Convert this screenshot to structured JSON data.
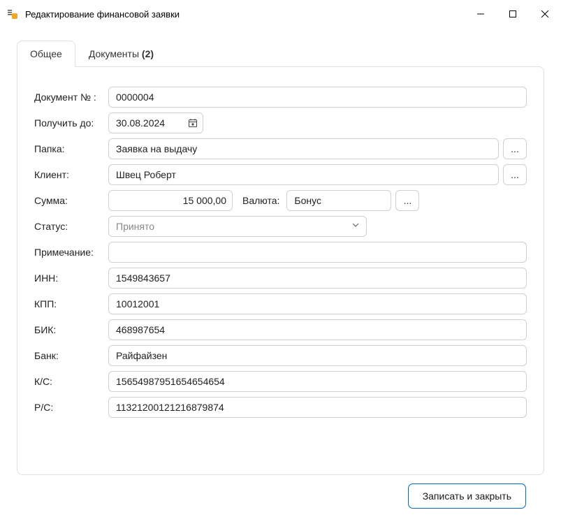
{
  "window": {
    "title": "Редактирование финансовой заявки"
  },
  "tabs": {
    "general": "Общее",
    "documents": "Документы",
    "documents_count": "(2)"
  },
  "labels": {
    "doc_number": "Документ № :",
    "receive_by": "Получить до:",
    "folder": "Папка:",
    "client": "Клиент:",
    "amount": "Сумма:",
    "currency": "Валюта:",
    "status": "Статус:",
    "note": "Примечание:",
    "inn": "ИНН:",
    "kpp": "КПП:",
    "bik": "БИК:",
    "bank": "Банк:",
    "ks": "К/С:",
    "rs": "Р/С:"
  },
  "values": {
    "doc_number": "0000004",
    "receive_by": "30.08.2024",
    "folder": "Заявка на выдачу",
    "client": "Швец Роберт",
    "amount": "15 000,00",
    "currency": "Бонус",
    "status": "Принято",
    "note": "",
    "inn": "1549843657",
    "kpp": "10012001",
    "bik": "468987654",
    "bank": "Райфайзен",
    "ks": "15654987951654654654",
    "rs": "11321200121216879874"
  },
  "buttons": {
    "ellipsis": "...",
    "save_close": "Записать и закрыть"
  }
}
